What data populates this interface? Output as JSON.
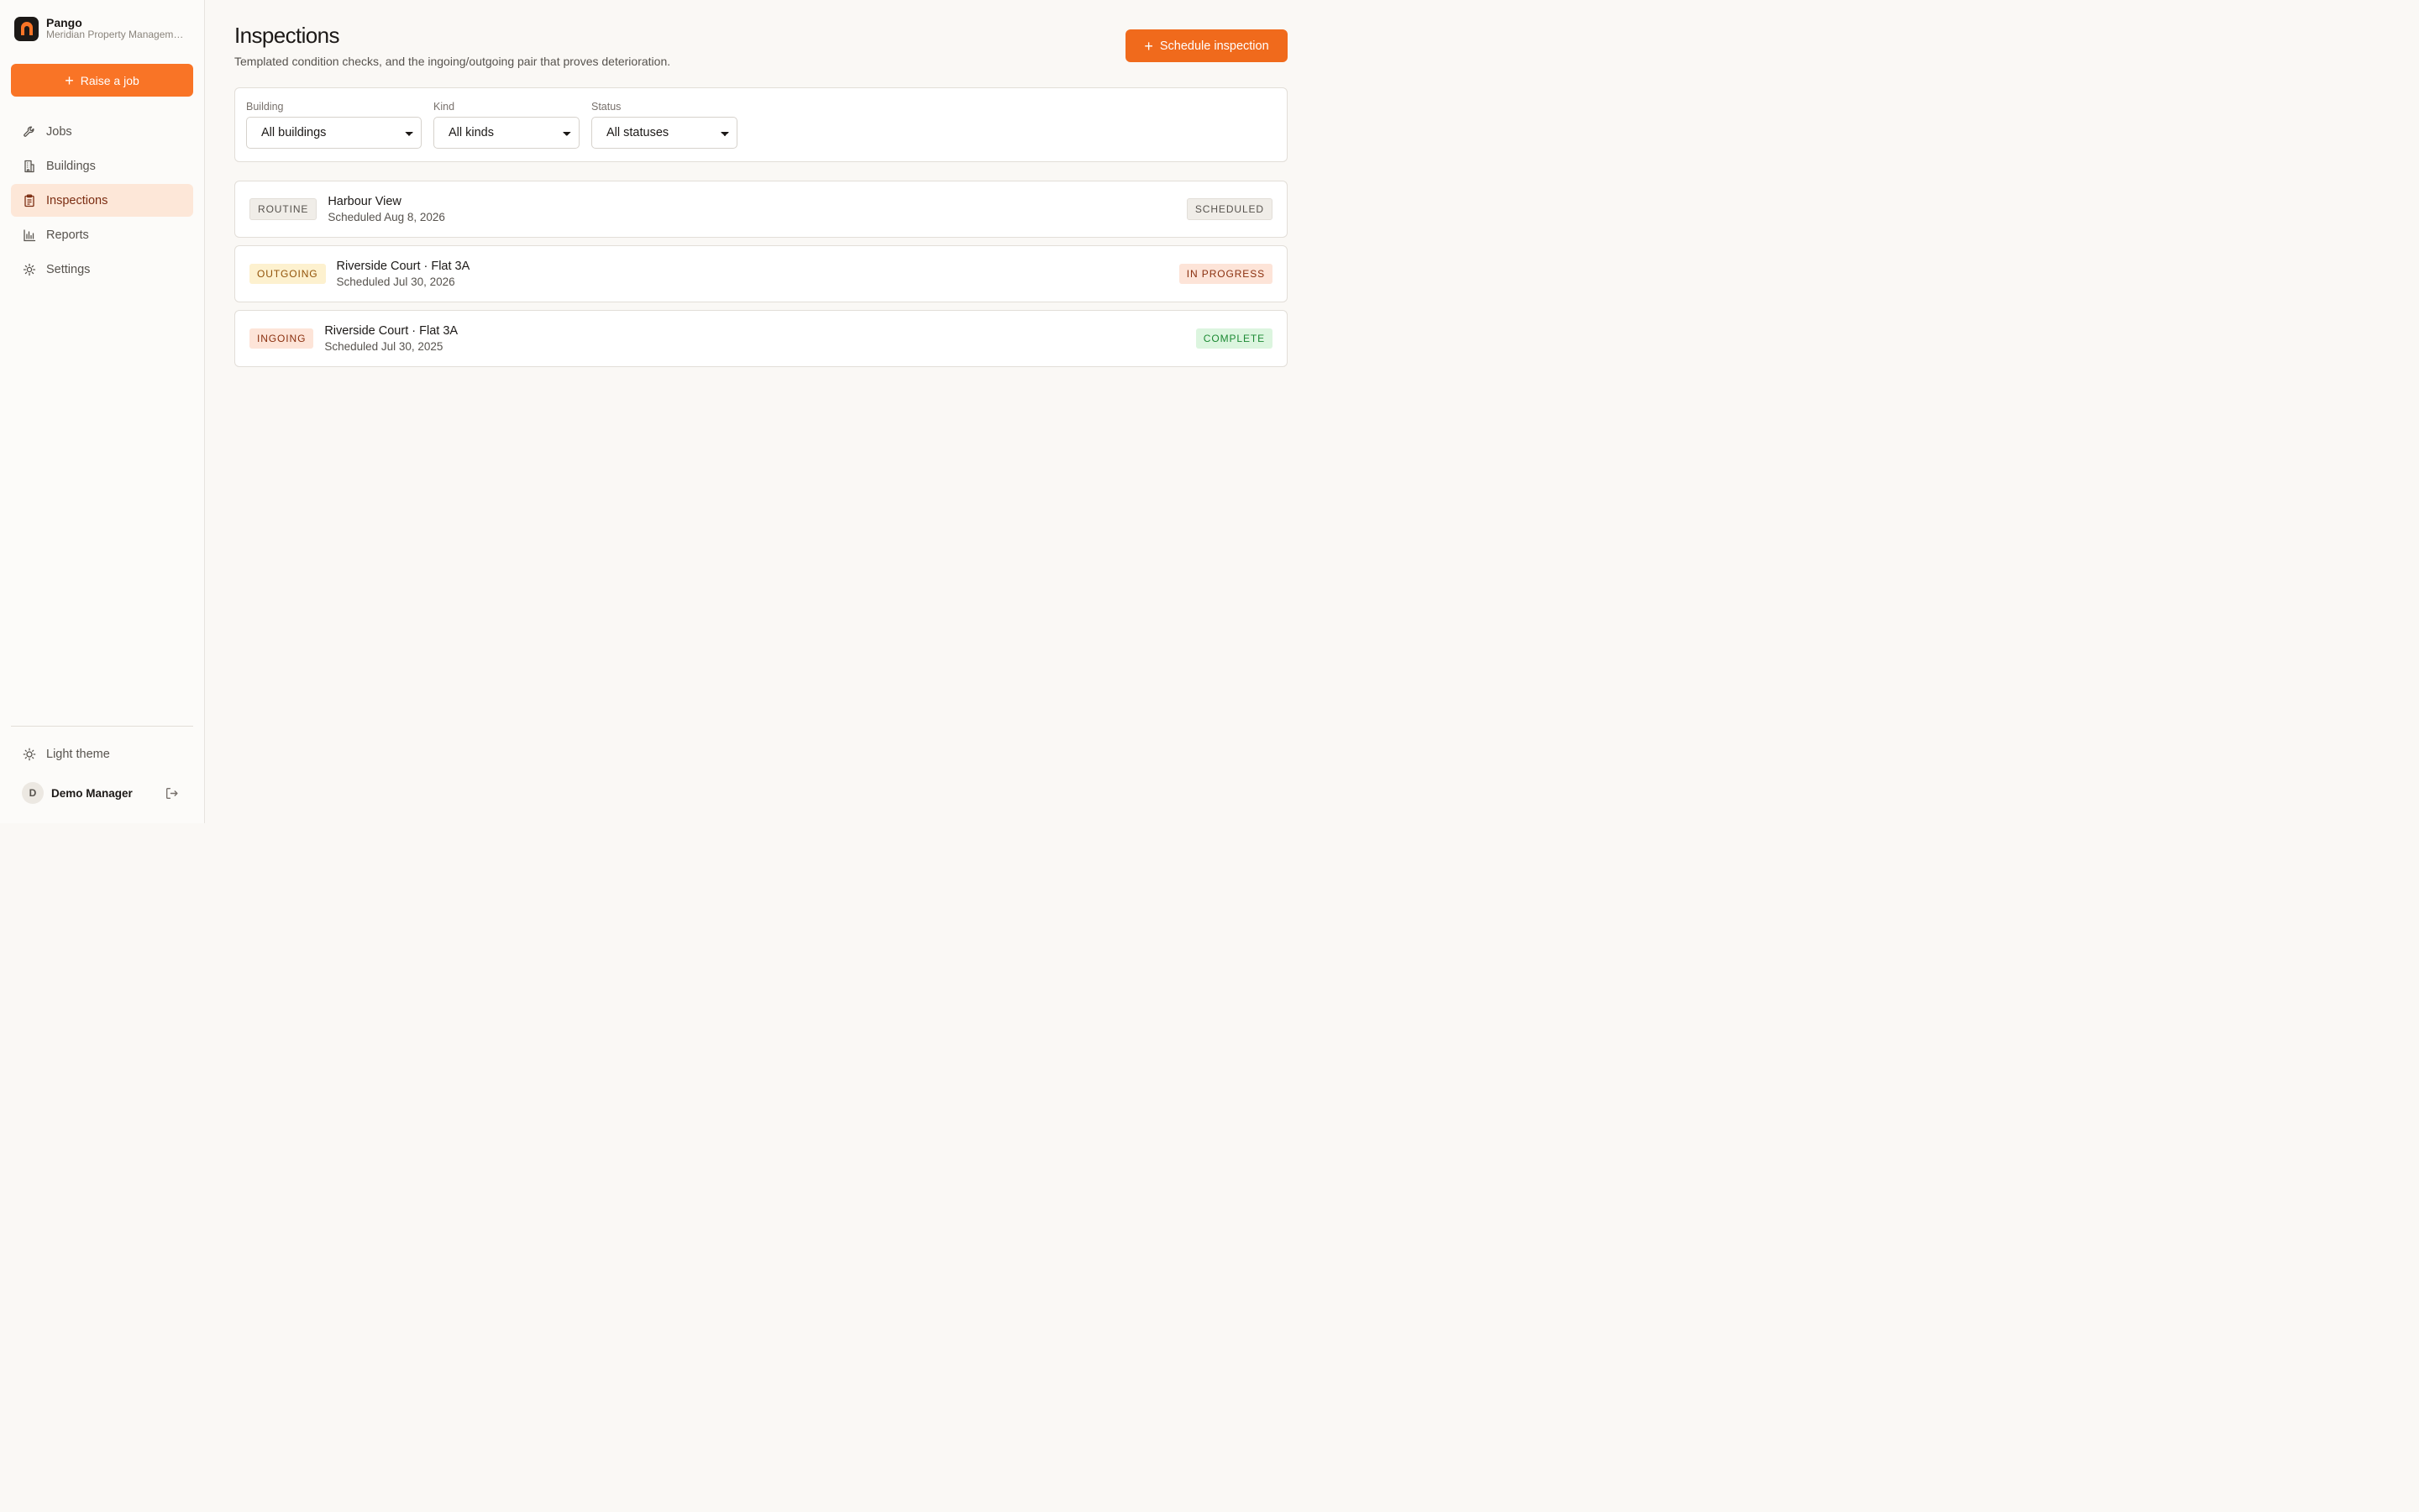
{
  "brand": {
    "name": "Pango",
    "org": "Meridian Property Management"
  },
  "sidebar": {
    "raise_label": "Raise a job",
    "items": [
      {
        "label": "Jobs",
        "icon": "wrench-icon"
      },
      {
        "label": "Buildings",
        "icon": "building-icon"
      },
      {
        "label": "Inspections",
        "icon": "clipboard-icon",
        "active": true
      },
      {
        "label": "Reports",
        "icon": "bar-chart-icon"
      },
      {
        "label": "Settings",
        "icon": "gear-icon"
      }
    ],
    "theme_label": "Light theme",
    "user": {
      "initial": "D",
      "name": "Demo Manager"
    }
  },
  "page": {
    "title": "Inspections",
    "subtitle": "Templated condition checks, and the ingoing/outgoing pair that proves deterioration.",
    "schedule_label": "Schedule inspection"
  },
  "filters": {
    "building": {
      "label": "Building",
      "value": "All buildings"
    },
    "kind": {
      "label": "Kind",
      "value": "All kinds"
    },
    "status": {
      "label": "Status",
      "value": "All statuses"
    }
  },
  "inspections": [
    {
      "kind": "ROUTINE",
      "title": "Harbour View",
      "subtitle": "Scheduled Aug 8, 2026",
      "status": "SCHEDULED"
    },
    {
      "kind": "OUTGOING",
      "title": "Riverside Court · Flat 3A",
      "subtitle": "Scheduled Jul 30, 2026",
      "status": "IN PROGRESS"
    },
    {
      "kind": "INGOING",
      "title": "Riverside Court · Flat 3A",
      "subtitle": "Scheduled Jul 30, 2025",
      "status": "COMPLETE"
    }
  ],
  "colors": {
    "accent": "#f97426",
    "active_nav_bg": "#fde7d8",
    "complete": "#1d8a34"
  }
}
